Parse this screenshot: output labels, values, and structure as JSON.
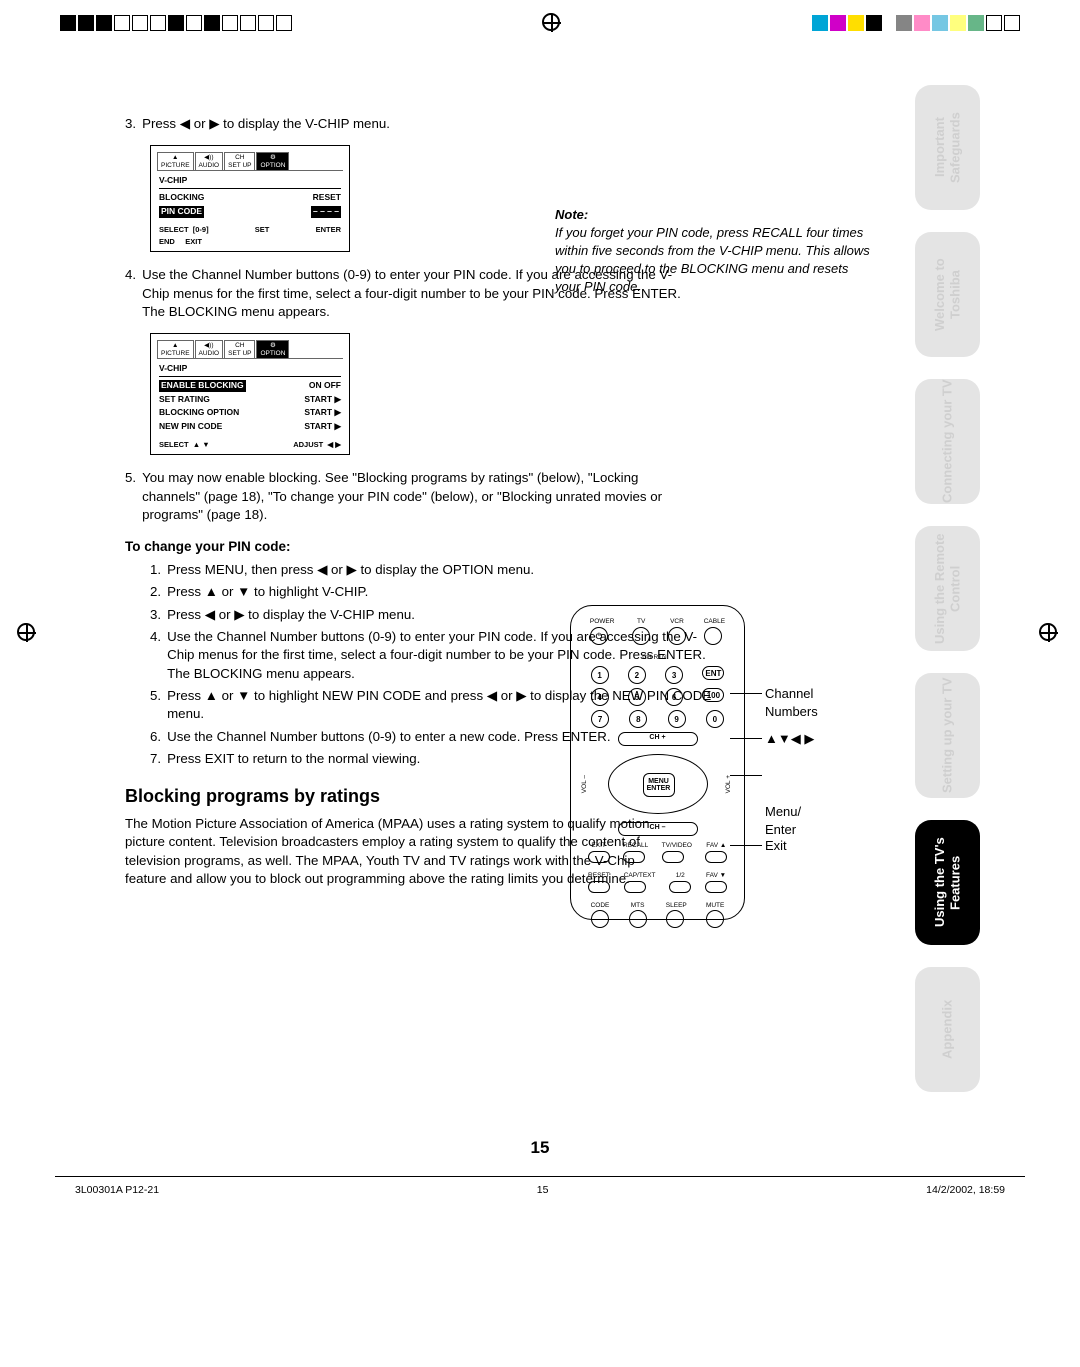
{
  "registration": {
    "crossmark": "crossmark",
    "ring": "ring"
  },
  "steps_a": {
    "s3_num": "3.",
    "s3": "Press ◀ or ▶ to display the V-CHIP menu.",
    "s4_num": "4.",
    "s4": "Use the Channel Number buttons (0-9) to enter your PIN code. If you are accessing the V-Chip menus for the first time, select a four-digit number to be your PIN code. Press ENTER. The BLOCKING menu appears.",
    "s5_num": "5.",
    "s5": "You may now enable blocking. See \"Blocking programs by ratings\" (below), \"Locking channels\" (page 18), \"To change your PIN code\" (below), or \"Blocking unrated movies or programs\" (page 18)."
  },
  "osd1": {
    "tabs": [
      "PICTURE",
      "AUDIO",
      "SET UP",
      "OPTION"
    ],
    "header": "V-CHIP",
    "r1a": "BLOCKING",
    "r1b": "RESET",
    "r2a": "PIN CODE",
    "r2b": "– – – –",
    "foot_l": "SELECT",
    "foot_l2": "[0-9]",
    "foot_m": "SET",
    "foot_r": "ENTER",
    "foot_bl": "END",
    "foot_bl2": "EXIT"
  },
  "osd2": {
    "tabs": [
      "PICTURE",
      "AUDIO",
      "SET UP",
      "OPTION"
    ],
    "header": "V-CHIP",
    "r1a": "ENABLE BLOCKING",
    "r1b": "ON OFF",
    "r2a": "SET RATING",
    "r2b": "START  ▶",
    "r3a": "BLOCKING OPTION",
    "r3b": "START  ▶",
    "r4a": "NEW PIN CODE",
    "r4b": "START  ▶",
    "foot_l": "SELECT",
    "foot_l2": "▲ ▼",
    "foot_m": "ADJUST",
    "foot_m2": "◀  ▶"
  },
  "change_pin_head": "To change your PIN code:",
  "change_pin": {
    "n1": "1.",
    "t1": "Press MENU, then press ◀ or ▶ to display the OPTION menu.",
    "n2": "2.",
    "t2": "Press ▲ or ▼ to highlight V-CHIP.",
    "n3": "3.",
    "t3": "Press ◀ or ▶ to display the V-CHIP menu.",
    "n4": "4.",
    "t4": "Use the Channel Number buttons (0-9) to enter your PIN code. If you are accessing the V-Chip menus for the first time, select a four-digit number to be your PIN code. Press ENTER. The BLOCKING menu appears.",
    "n5": "5.",
    "t5": "Press ▲ or ▼ to highlight NEW PIN CODE and press ◀ or ▶ to display the NEW PIN CODE menu.",
    "n6": "6.",
    "t6": "Use the Channel Number buttons (0-9) to enter a new code. Press ENTER.",
    "n7": "7.",
    "t7": "Press EXIT to return to the normal viewing."
  },
  "h2": "Blocking programs by ratings",
  "para": "The Motion Picture Association of America (MPAA) uses a rating system to qualify motion picture content. Television broadcasters employ a rating system to qualify the content of television programs, as well. The MPAA, Youth TV and TV ratings work with the V-Chip feature and allow you to block out programming above the rating limits you determine.",
  "note": {
    "head": "Note:",
    "body": "If you forget your PIN code, press RECALL four times within five seconds from the V-CHIP menu. This allows you to proceed to the BLOCKING menu and resets your PIN code."
  },
  "remote": {
    "row1": [
      "POWER",
      "TV",
      "VCR",
      "CABLE"
    ],
    "chrtn": "CH RTN",
    "nums": [
      "1",
      "2",
      "3",
      "4",
      "5",
      "6",
      "7",
      "8",
      "9",
      "0"
    ],
    "ent": "ENT",
    "hundred": "100",
    "chp": "CH +",
    "chm": "CH –",
    "voln": "VOL –",
    "volp": "VOL +",
    "menu": "MENU",
    "enter": "ENTER",
    "row_a": [
      "EXIT",
      "RECALL",
      "TV/VIDEO",
      "FAV ▲"
    ],
    "row_b": [
      "RESET",
      "CAP/TEXT",
      "1/2",
      "FAV ▼"
    ],
    "row_c": [
      "CODE",
      "MTS",
      "SLEEP",
      "MUTE"
    ]
  },
  "callouts": {
    "ch": "Channel Numbers",
    "arrows": "▲▼◀ ▶",
    "menu": "Menu/\nEnter",
    "exit": "Exit"
  },
  "tabs": {
    "t1": "Important Safeguards",
    "t2": "Welcome to Toshiba",
    "t3": "Connecting your TV",
    "t4": "Using the Remote Control",
    "t5": "Setting up your TV",
    "t6": "Using the TV's Features",
    "t7": "Appendix"
  },
  "page_number": "15",
  "footer": {
    "left": "3L00301A P12-21",
    "mid": "15",
    "right": "14/2/2002, 18:59"
  }
}
